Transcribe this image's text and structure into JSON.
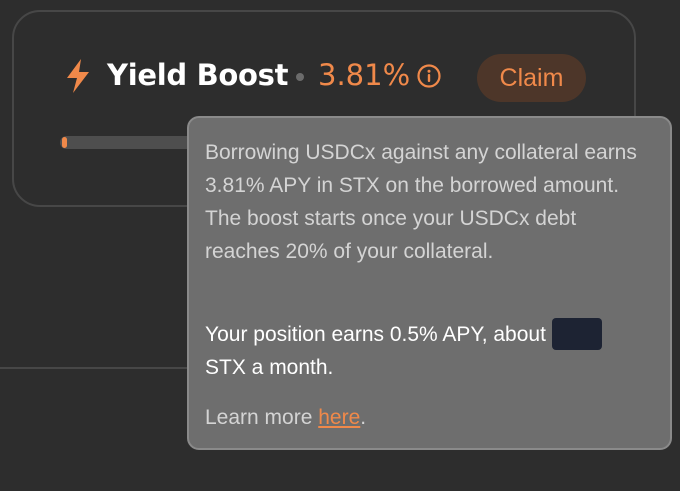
{
  "card": {
    "title": "Yield Boost",
    "rate": "3.81%",
    "claim_label": "Claim",
    "progress": 0.03
  },
  "tooltip": {
    "paragraph1": "Borrowing USDCx against any collateral earns 3.81% APY in STX on the borrowed amount. The boost starts once your USDCx debt reaches 20% of your collateral.",
    "paragraph2_before": "Your position earns 0.5% APY, about",
    "paragraph2_after": "STX a month.",
    "learn_more_prefix": "Learn more ",
    "learn_more_link": "here",
    "learn_more_suffix": "."
  },
  "icons": {
    "bolt": "lightning-bolt-icon",
    "info": "info-icon"
  },
  "colors": {
    "accent": "#f0894a",
    "background": "#2d2d2d",
    "tooltip_bg": "#6e6e6e",
    "redaction": "#1d2333"
  }
}
